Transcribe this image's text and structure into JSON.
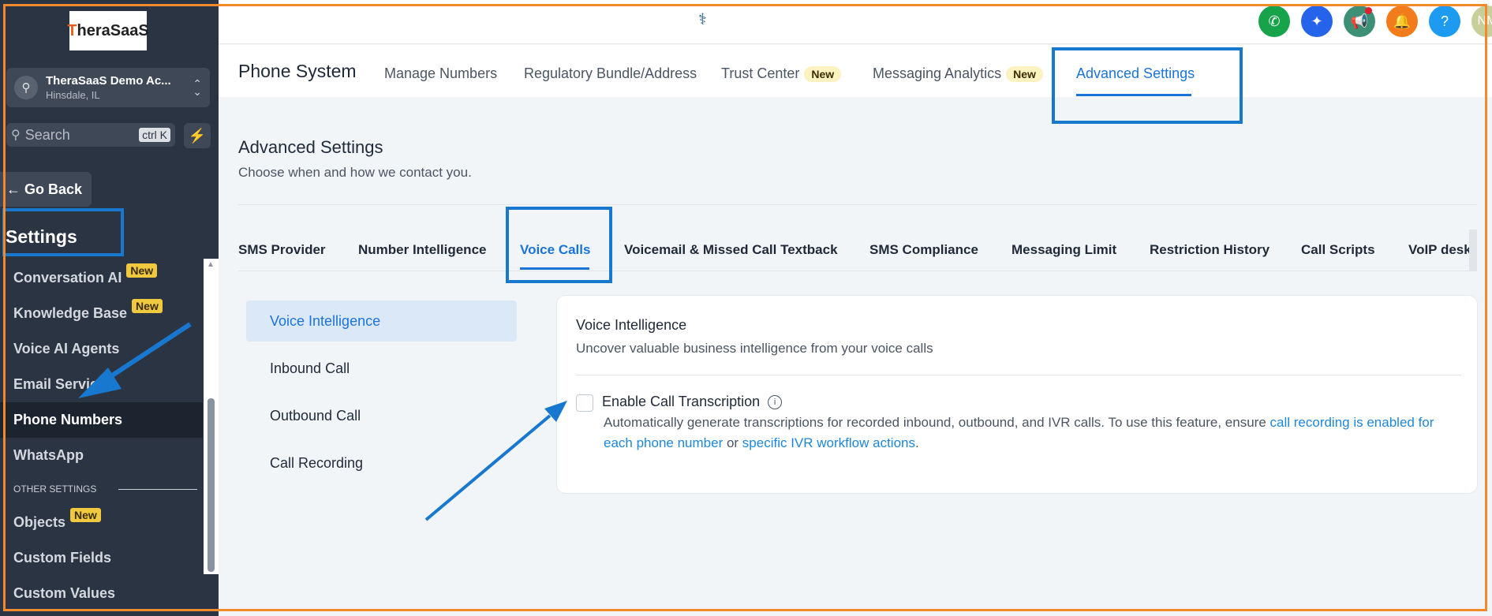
{
  "sidebar": {
    "logo_text": "TheraSaaS",
    "account": {
      "name": "TheraSaaS Demo Ac...",
      "location": "Hinsdale, IL"
    },
    "search": {
      "placeholder": "Search",
      "shortcut": "ctrl K"
    },
    "go_back": "← Go Back",
    "title": "Settings",
    "items": [
      {
        "label": "Conversation AI",
        "badge": "New"
      },
      {
        "label": "Knowledge Base",
        "badge": "New"
      },
      {
        "label": "Voice AI Agents"
      },
      {
        "label": "Email Services"
      },
      {
        "label": "Phone Numbers",
        "active": true
      },
      {
        "label": "WhatsApp"
      }
    ],
    "section_label": "OTHER SETTINGS",
    "items2": [
      {
        "label": "Objects",
        "badge": "New"
      },
      {
        "label": "Custom Fields"
      },
      {
        "label": "Custom Values"
      }
    ]
  },
  "topbar": {
    "avatar_initials": "NM",
    "icons": [
      "phone-icon",
      "ai-sparkle-icon",
      "megaphone-icon",
      "bell-icon",
      "help-icon"
    ]
  },
  "subnav": {
    "title": "Phone System",
    "tabs": [
      {
        "label": "Manage Numbers"
      },
      {
        "label": "Regulatory Bundle/Address"
      },
      {
        "label": "Trust Center",
        "badge": "New"
      },
      {
        "label": "Messaging Analytics",
        "badge": "New"
      },
      {
        "label": "Advanced Settings",
        "active": true
      }
    ]
  },
  "advanced": {
    "title": "Advanced Settings",
    "subtitle": "Choose when and how we contact you.",
    "tabs": [
      "SMS Provider",
      "Number Intelligence",
      "Voice Calls",
      "Voicemail & Missed Call Textback",
      "SMS Compliance",
      "Messaging Limit",
      "Restriction History",
      "Call Scripts",
      "VoIP deskp"
    ],
    "active_tab": "Voice Calls",
    "submenu": [
      "Voice Intelligence",
      "Inbound Call",
      "Outbound Call",
      "Call Recording"
    ],
    "card": {
      "title": "Voice Intelligence",
      "subtitle": "Uncover valuable business intelligence from your voice calls",
      "checkbox_label": "Enable Call Transcription",
      "checked": false,
      "desc_prefix": "Automatically generate transcriptions for recorded inbound, outbound, and IVR calls. To use this feature, ensure ",
      "desc_link1": "call recording is enabled for each phone number",
      "desc_mid": " or ",
      "desc_link2": "specific IVR workflow actions",
      "desc_suffix": "."
    }
  },
  "colors": {
    "accent": "#1a73d9",
    "sidebar_bg": "#2b3442",
    "annotation_blue": "#1878d0",
    "annotation_frame": "#f18a2a",
    "badge_yellow": "#f0c93f"
  }
}
